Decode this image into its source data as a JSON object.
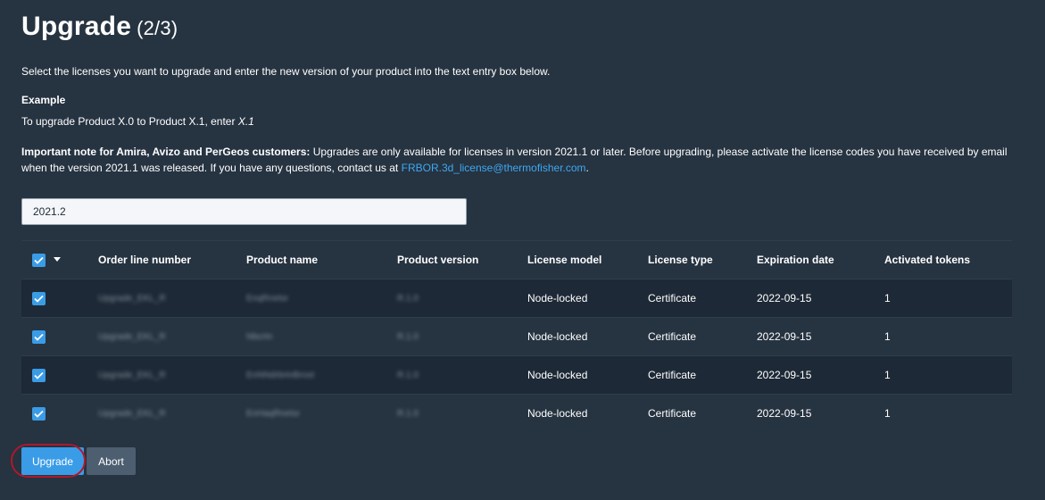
{
  "page": {
    "title": "Upgrade",
    "step": "(2/3)",
    "intro": "Select the licenses you want to upgrade and enter the new version of your product into the text entry box below.",
    "example_heading": "Example",
    "example_text_prefix": "To upgrade Product X.0 to Product X.1, enter ",
    "example_text_value": "X.1",
    "note_bold": "Important note for Amira, Avizo and PerGeos customers:",
    "note_text": " Upgrades are only available for licenses in version 2021.1 or later. Before upgrading, please activate the license codes you have received by email when the version 2021.1 was released. If you have any questions, contact us at ",
    "note_email": "FRBOR.3d_license@thermofisher.com",
    "note_end": "."
  },
  "version_input": {
    "value": "2021.2"
  },
  "table": {
    "columns": {
      "order": "Order line number",
      "pname": "Product name",
      "pver": "Product version",
      "model": "License model",
      "type": "License type",
      "exp": "Expiration date",
      "tokens": "Activated tokens"
    },
    "rows": [
      {
        "checked": true,
        "order": "Upgrade_EKL_R",
        "pname": "EnqRnetsr",
        "pver": "R.1.0",
        "model": "Node-locked",
        "type": "Certificate",
        "exp": "2022-09-15",
        "tokens": "1"
      },
      {
        "checked": true,
        "order": "Upgrade_EKL_R",
        "pname": "Nbcrtn",
        "pver": "R.1.0",
        "model": "Node-locked",
        "type": "Certificate",
        "exp": "2022-09-15",
        "tokens": "1"
      },
      {
        "checked": true,
        "order": "Upgrade_EKL_R",
        "pname": "EnNNdrbrtnBrost",
        "pver": "R.1.0",
        "model": "Node-locked",
        "type": "Certificate",
        "exp": "2022-09-15",
        "tokens": "1"
      },
      {
        "checked": true,
        "order": "Upgrade_EKL_R",
        "pname": "EnHaqRnetsr",
        "pver": "R.1.0",
        "model": "Node-locked",
        "type": "Certificate",
        "exp": "2022-09-15",
        "tokens": "1"
      }
    ]
  },
  "buttons": {
    "upgrade": "Upgrade",
    "abort": "Abort"
  },
  "colors": {
    "background": "#263341",
    "accent": "#3a9ce6",
    "link": "#3ea8f0",
    "highlight": "#b0182a"
  },
  "icons": {
    "checkbox": "checkmark-icon",
    "select_menu": "caret-down-icon"
  }
}
